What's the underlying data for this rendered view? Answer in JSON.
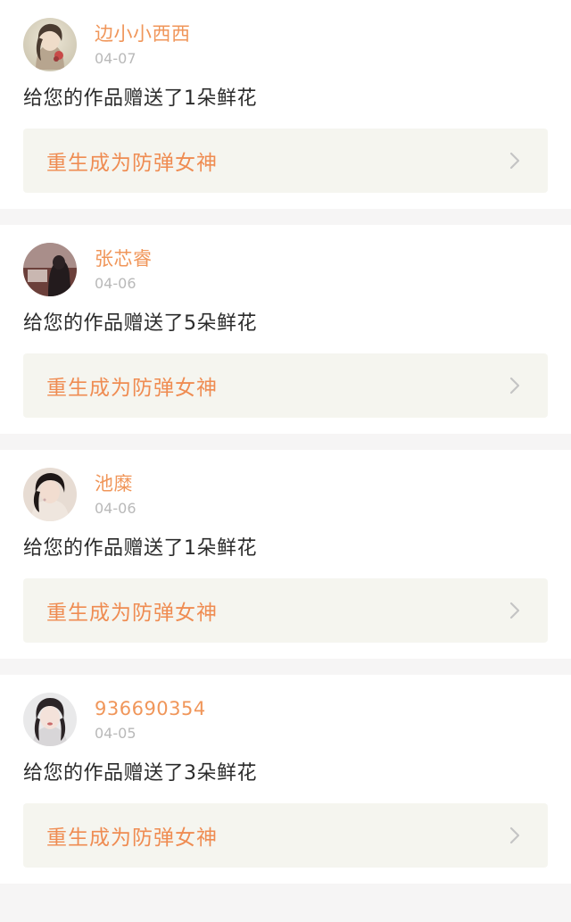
{
  "notifications": [
    {
      "username": "边小小西西",
      "date": "04-07",
      "message": "给您的作品赠送了1朵鲜花",
      "work_title": "重生成为防弹女神",
      "avatar_icon": "avatar-photo"
    },
    {
      "username": "张芯睿",
      "date": "04-06",
      "message": "给您的作品赠送了5朵鲜花",
      "work_title": "重生成为防弹女神",
      "avatar_icon": "avatar-photo"
    },
    {
      "username": "池糜",
      "date": "04-06",
      "message": "给您的作品赠送了1朵鲜花",
      "work_title": "重生成为防弹女神",
      "avatar_icon": "avatar-photo"
    },
    {
      "username": "936690354",
      "date": "04-05",
      "message": "给您的作品赠送了3朵鲜花",
      "work_title": "重生成为防弹女神",
      "avatar_icon": "avatar-photo"
    }
  ],
  "colors": {
    "username": "#f0965a",
    "work_title": "#ef8c52",
    "date": "#b9b9b9",
    "message": "#2b2b2b",
    "link_bg": "#f5f5ef",
    "page_bg": "#f6f5f5"
  },
  "icons": {
    "chevron": "chevron-right-icon"
  }
}
